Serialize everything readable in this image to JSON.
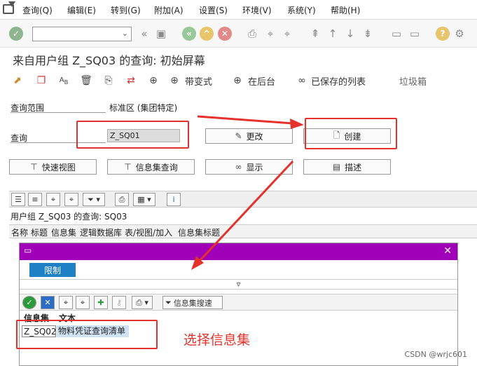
{
  "menu": [
    "查询(Q)",
    "编辑(E)",
    "转到(G)",
    "附加(A)",
    "设置(S)",
    "环境(V)",
    "系统(Y)",
    "帮助(H)"
  ],
  "screen_title": "来自用户组 Z_SQ03 的查询: 初始屏幕",
  "app_toolbar": {
    "with_variant": "带变式",
    "in_background": "在后台",
    "saved_lists": "已保存的列表",
    "trash": "垃圾箱"
  },
  "form": {
    "query_area_label": "查询范围",
    "query_area_value": "标准区 (集团特定)",
    "query_label": "查询",
    "query_value": "Z_SQ01"
  },
  "buttons": {
    "change": "更改",
    "create": "创建",
    "quick_view": "快速视图",
    "infoset_query": "信息集查询",
    "display": "显示",
    "describe": "描述"
  },
  "grid": {
    "title": "用户组 Z_SQ03 的查询: SQ03",
    "columns": [
      "名称",
      "标题",
      "信息集",
      "逻辑数据库",
      "表/视图/加入",
      "信息集标题"
    ]
  },
  "popup": {
    "tab": "限制",
    "search_button": "信息集搜速",
    "headers": [
      "信息集",
      "文本"
    ],
    "rows": [
      {
        "id": "Z_SQ02",
        "text": "物料凭证查询清单"
      }
    ]
  },
  "annotation": "选择信息集",
  "watermark": "CSDN @wrjc601",
  "colors": {
    "highlight": "#e5312c",
    "popup_title": "#a000b8",
    "tab": "#1f80c6"
  }
}
